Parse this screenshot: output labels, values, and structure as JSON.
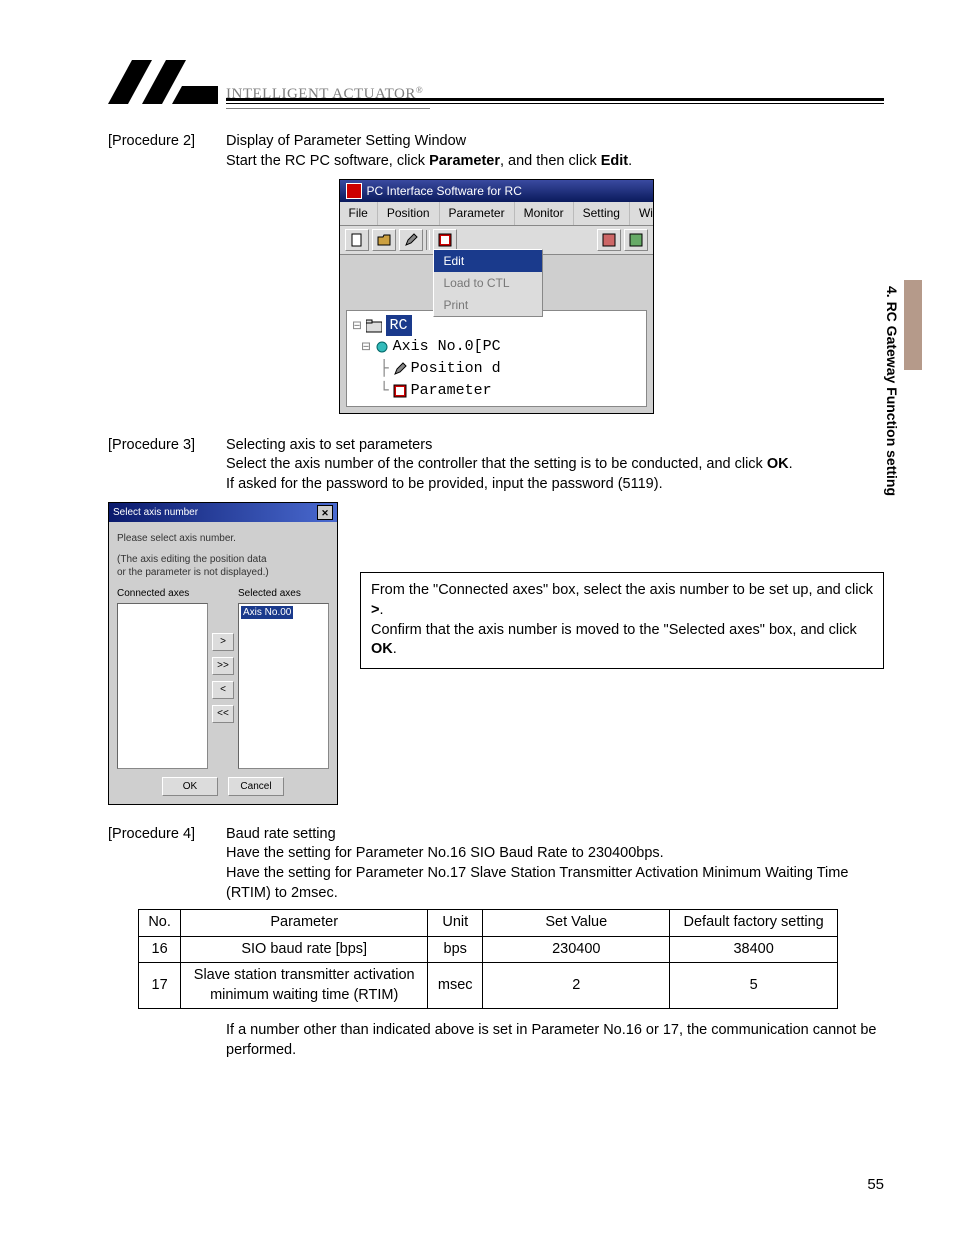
{
  "side_tab": "4.  RC Gateway Function setting",
  "brand": "INTELLIGENT ACTUATOR",
  "proc2": {
    "label": "[Procedure 2]",
    "title": "Display of Parameter Setting Window",
    "line2a": "Start the RC PC software, click ",
    "line2b": "Parameter",
    "line2c": ", and then click ",
    "line2d": "Edit",
    "line2e": "."
  },
  "shot1": {
    "title": "PC Interface Software for RC",
    "menu": [
      "File",
      "Position",
      "Parameter",
      "Monitor",
      "Setting",
      "Wi"
    ],
    "dropdown": {
      "item1": "Edit",
      "item2": "Load to CTL",
      "item3": "Print"
    },
    "tree": {
      "root": "RC",
      "n1": "Axis No.0[PC",
      "n2": "Position d",
      "n3": "Parameter"
    }
  },
  "proc3": {
    "label": "[Procedure 3]",
    "title": "Selecting axis to set parameters",
    "line1a": "Select the axis number of the controller that the setting is to be conducted, and click ",
    "line1b": "OK",
    "line1c": ".",
    "line2": "If asked for the password to be provided, input the password (5119)."
  },
  "shot2": {
    "title": "Select axis number",
    "hint1": "Please select axis number.",
    "hint2": "(The axis editing the position data\n or the parameter is not displayed.)",
    "connected_label": "Connected axes",
    "selected_label": "Selected axes",
    "selected_item": "Axis No.00",
    "btn_r": ">",
    "btn_rr": ">>",
    "btn_l": "<",
    "btn_ll": "<<",
    "ok": "OK",
    "cancel": "Cancel"
  },
  "callout": {
    "l1a": "From the \"Connected axes\" box, select the axis number to be set up, and click ",
    "l1b": ">",
    "l1c": ".",
    "l2a": "Confirm that the axis number is moved to the \"Selected axes\" box, and click ",
    "l2b": "OK",
    "l2c": "."
  },
  "proc4": {
    "label": "[Procedure 4]",
    "title": "Baud rate setting",
    "line1": "Have the setting for Parameter No.16 SIO Baud Rate to 230400bps.",
    "line2": "Have the setting for Parameter No.17 Slave Station Transmitter Activation Minimum Waiting Time (RTIM) to 2msec."
  },
  "table": {
    "headers": {
      "no": "No.",
      "param": "Parameter",
      "unit": "Unit",
      "val": "Set Value",
      "def": "Default factory setting"
    },
    "rows": [
      {
        "no": "16",
        "param": "SIO baud rate [bps]",
        "unit": "bps",
        "val": "230400",
        "def": "38400"
      },
      {
        "no": "17",
        "param": "Slave station transmitter activation minimum waiting time (RTIM)",
        "unit": "msec",
        "val": "2",
        "def": "5"
      }
    ]
  },
  "footnote": "If a number other than indicated above is set in Parameter No.16 or 17, the communication cannot be performed.",
  "page_number": "55"
}
